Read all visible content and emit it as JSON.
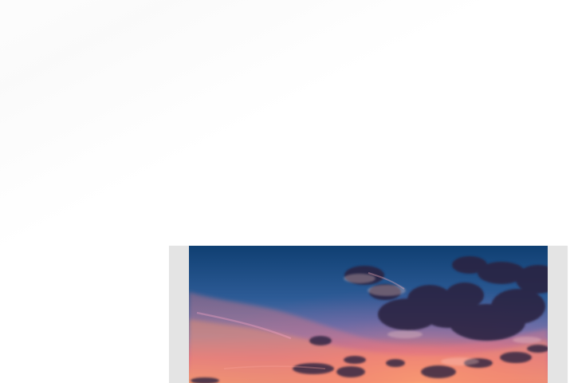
{
  "scene": {
    "background_color": "#ffffff",
    "photo": {
      "subject": "sunset-sky-with-clouds",
      "colors": {
        "sky_top": "#0f3f72",
        "sky_mid": "#2e5f99",
        "sky_lower": "#6c7bb1",
        "glow_pink": "#d96f87",
        "glow_orange": "#f2a36b",
        "cloud_dark": "#2d2340",
        "card_border": "#e4e4e4"
      }
    }
  }
}
